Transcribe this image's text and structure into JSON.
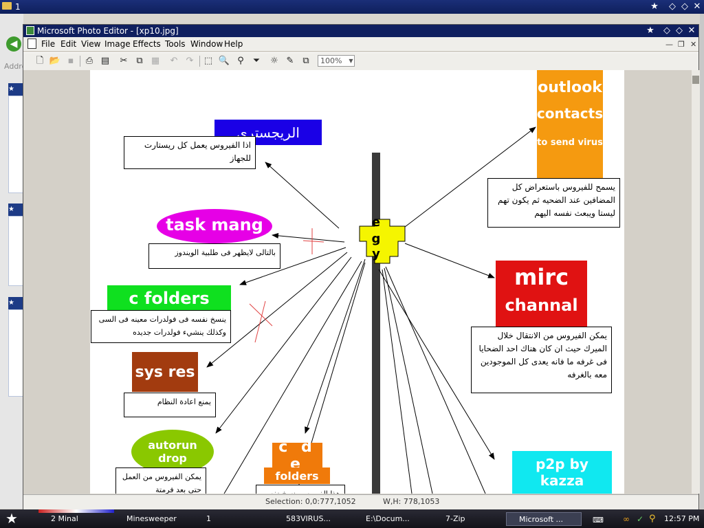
{
  "background_window": {
    "title": "1",
    "address_label": "Addre"
  },
  "window": {
    "title": "Microsoft Photo Editor - [xp10.jpg]",
    "menu": [
      "File",
      "Edit",
      "View",
      "Image",
      "Effects",
      "Tools",
      "Window",
      "Help"
    ],
    "zoom": "100%"
  },
  "status": {
    "selection": "Selection: 0,0:777,1052",
    "size": "W,H: 778,1053"
  },
  "diagram": {
    "center_letters": [
      "e",
      "g",
      "y"
    ],
    "nodes": {
      "registry": {
        "title": "الريجسترى",
        "note": "اذا الفيروس يعمل كل ريستارت للجهاز"
      },
      "task_mang": {
        "title": "task mang",
        "note": "بالتالى لايظهر فى طلبية الويندوز"
      },
      "c_folders": {
        "title": "c folders",
        "note": "ينسخ نفسه فى فولدرات معينه فى السى وكذلك ينشيء فولدرات جديده"
      },
      "sys_res": {
        "title": "sys res",
        "note": "يمنع اعادة النظام"
      },
      "autorun": {
        "title": "autorun drop",
        "note": "يمكن الفيروس من العمل حتى بعد فرمتة"
      },
      "cde_folders": {
        "title": "c d e",
        "subtitle": "folders",
        "note": "هذا الفيروس ينسخ نفسه فى كل"
      },
      "outlook": {
        "title1": "outlook",
        "title2": "contacts",
        "title3": "to send virus",
        "note": "يسمح للفيروس باستعراض كل المضافين عند الضحيه ثم يكون تهم ليستا ويبعث نفسه اليهم"
      },
      "mirc": {
        "title1": "mirc",
        "title2": "channal",
        "note": "يمكن الفيروس من الانتقال خلال الميرك حيث ان كان هناك احد الضحايا فى غرفه ما فانه يعدى كل الموجودين معه بالغرفه"
      },
      "p2p": {
        "title": "p2p by kazza"
      }
    }
  },
  "taskbar": {
    "tasks": [
      "2 Minal",
      "Minesweeper",
      "1",
      "583VIRUS...",
      "E:\\Docum...",
      "7-Zip",
      "Microsoft ..."
    ],
    "clock": "12:57 PM"
  },
  "colors": {
    "registry": "#1a00e6",
    "task_mang": "#e600e6",
    "c_folders": "#0fe01f",
    "sys_res": "#a23b0f",
    "autorun": "#8ac800",
    "cde": "#f07a0a",
    "outlook": "#f59a10",
    "mirc": "#e01212",
    "p2p": "#10e8f0",
    "center": "#f5f500",
    "bar": "#3a3a3a"
  }
}
